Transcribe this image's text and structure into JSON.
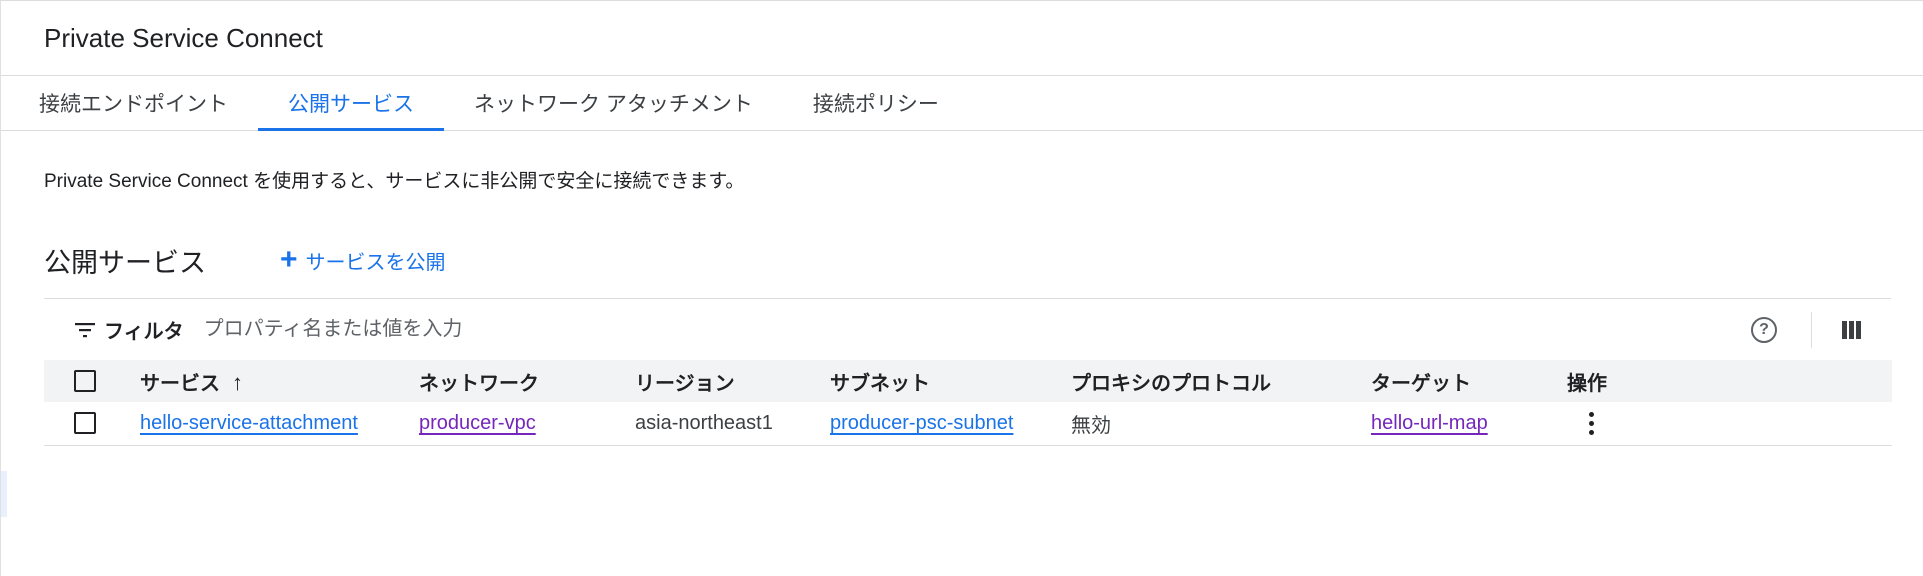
{
  "header": {
    "title": "Private Service Connect"
  },
  "tabs": [
    {
      "label": "接続エンドポイント",
      "active": false
    },
    {
      "label": "公開サービス",
      "active": true
    },
    {
      "label": "ネットワーク アタッチメント",
      "active": false
    },
    {
      "label": "接続ポリシー",
      "active": false
    }
  ],
  "description": "Private Service Connect を使用すると、サービスに非公開で安全に接続できます。",
  "section": {
    "title": "公開サービス",
    "publish_label": "サービスを公開",
    "publish_icon": "plus-icon"
  },
  "filter": {
    "label": "フィルタ",
    "placeholder": "プロパティ名または値を入力",
    "icons": [
      "filter-icon",
      "help-icon",
      "column-display-icon"
    ]
  },
  "table": {
    "columns": [
      "サービス",
      "ネットワーク",
      "リージョン",
      "サブネット",
      "プロキシのプロトコル",
      "ターゲット",
      "操作"
    ],
    "sort_icon": "arrow-up-icon",
    "rows": [
      {
        "service": "hello-service-attachment",
        "network": "producer-vpc",
        "region": "asia-northeast1",
        "subnet": "producer-psc-subnet",
        "proxy_protocol": "無効",
        "target": "hello-url-map",
        "actions_icon": "more-vert-icon"
      }
    ]
  },
  "colors": {
    "accent": "#1a73e8",
    "visited_link": "#7627bb",
    "header_row": "#f1f3f4",
    "border": "#dadce0"
  }
}
